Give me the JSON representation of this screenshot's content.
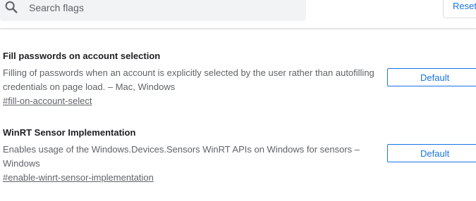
{
  "search": {
    "placeholder": "Search flags",
    "value": ""
  },
  "toolbar": {
    "reset_label": "Reset"
  },
  "flags": [
    {
      "title": "Fill passwords on account selection",
      "description": "Filling of passwords when an account is explicitly selected by the user rather than autofilling credentials on page load. – Mac, Windows",
      "link": "#fill-on-account-select",
      "selected": "Default"
    },
    {
      "title": "WinRT Sensor Implementation",
      "description": "Enables usage of the Windows.Devices.Sensors WinRT APIs on Windows for sensors – Windows",
      "link": "#enable-winrt-sensor-implementation",
      "selected": "Default"
    }
  ],
  "colors": {
    "accent": "#1a73e8",
    "text": "#202124",
    "secondary": "#5f6368",
    "search_bg": "#f1f3f4"
  },
  "icons": {
    "search": "search-icon"
  }
}
